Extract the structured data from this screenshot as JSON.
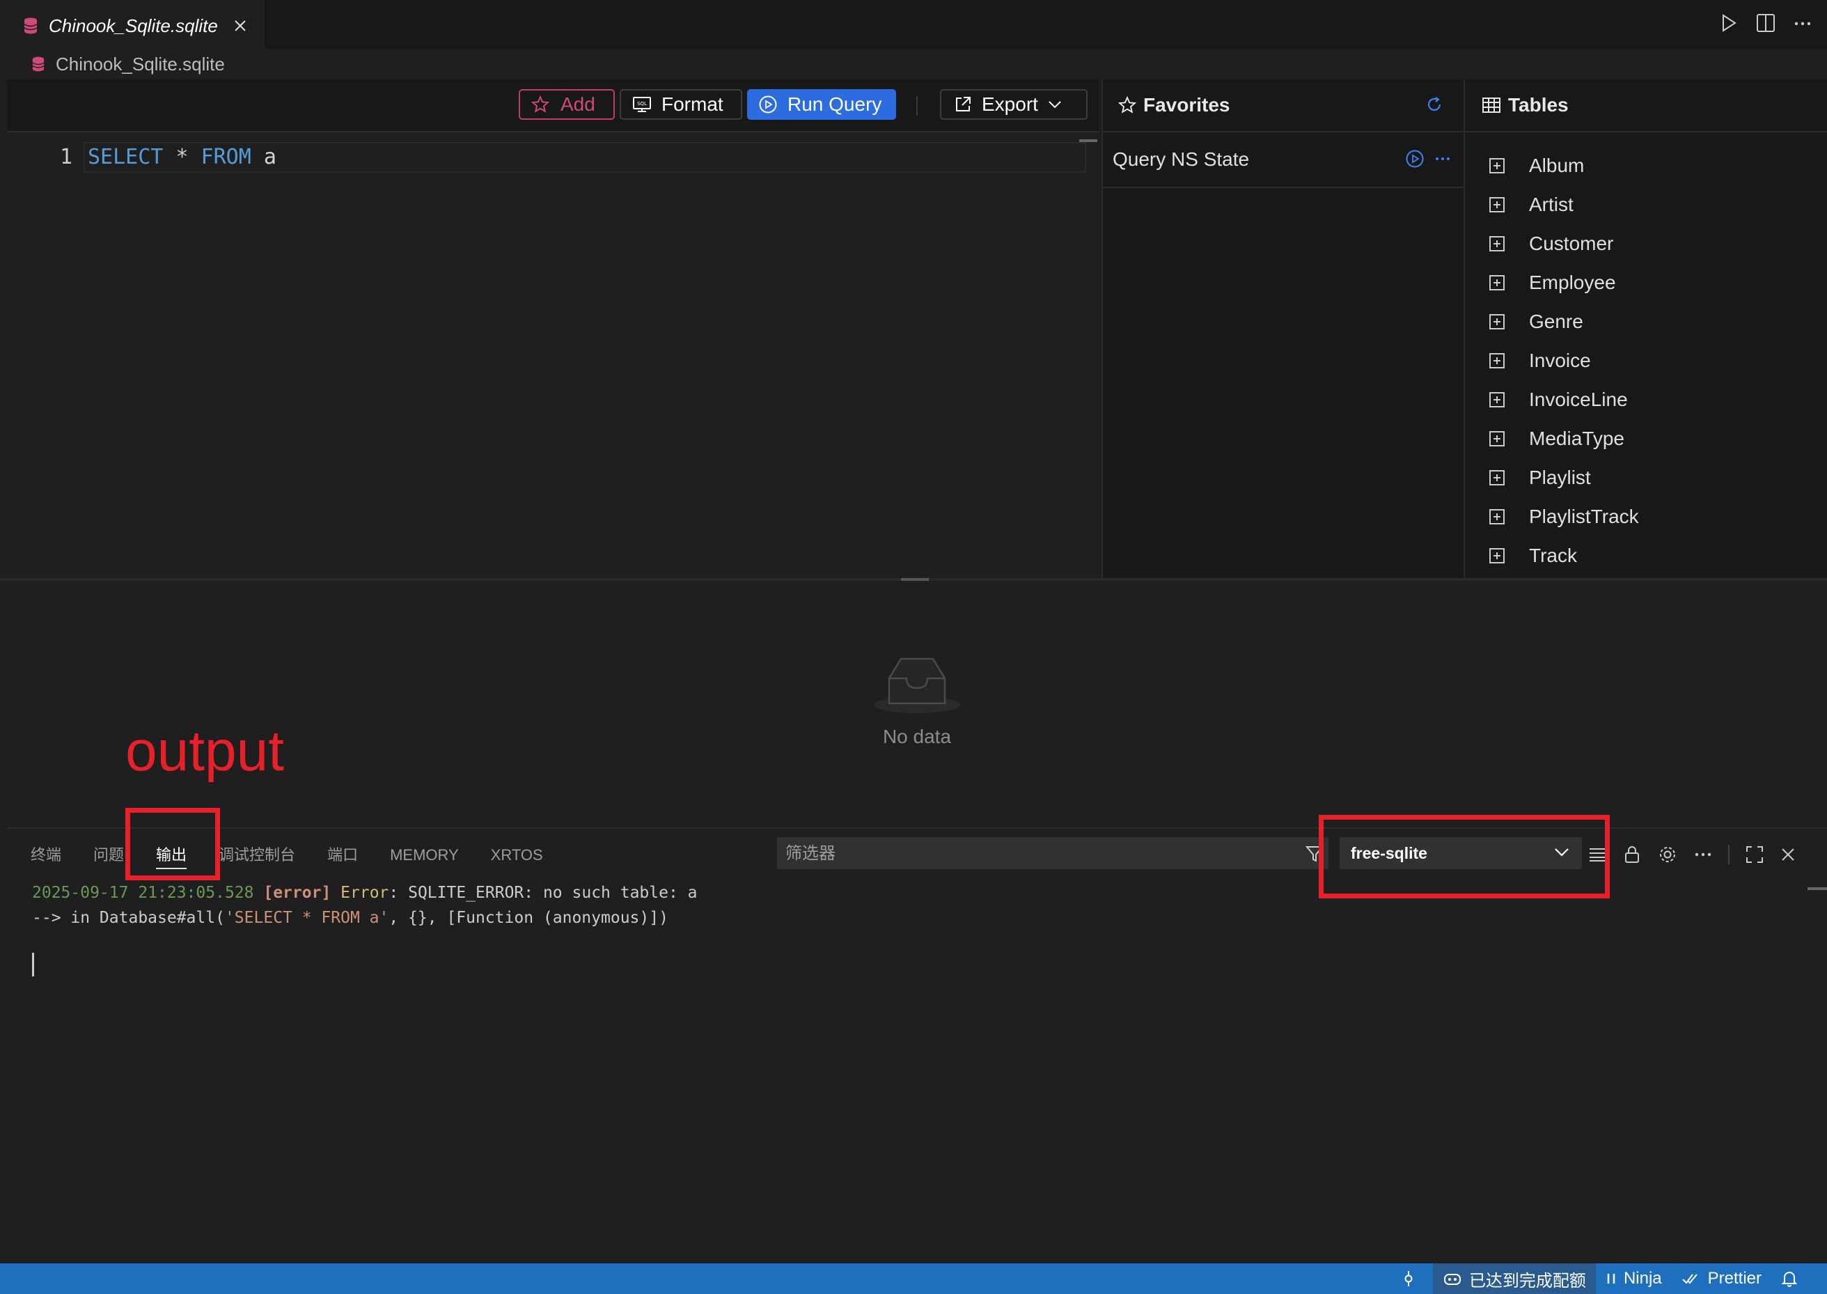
{
  "tab": {
    "title": "Chinook_Sqlite.sqlite"
  },
  "breadcrumb": {
    "label": "Chinook_Sqlite.sqlite"
  },
  "toolbar": {
    "add": "Add",
    "format": "Format",
    "run": "Run Query",
    "export": "Export"
  },
  "editor": {
    "line_number": "1",
    "code": {
      "kw1": "SELECT",
      "star": "*",
      "kw2": "FROM",
      "ident": "a"
    }
  },
  "favorites": {
    "title": "Favorites",
    "items": [
      {
        "label": "Query NS State"
      }
    ]
  },
  "tables": {
    "title": "Tables",
    "items": [
      "Album",
      "Artist",
      "Customer",
      "Employee",
      "Genre",
      "Invoice",
      "InvoiceLine",
      "MediaType",
      "Playlist",
      "PlaylistTrack",
      "Track"
    ]
  },
  "results": {
    "empty": "No data"
  },
  "annotation": {
    "label": "output"
  },
  "panel": {
    "tabs": [
      "终端",
      "问题",
      "输出",
      "调试控制台",
      "端口",
      "MEMORY",
      "XRTOS"
    ],
    "active_tab": "输出",
    "filter_placeholder": "筛选器",
    "channel": "free-sqlite",
    "log": {
      "timestamp": "2025-09-17 21:23:05.528",
      "level": "[error]",
      "error_word": "Error",
      "message": ": SQLITE_ERROR: no such table: a",
      "line2_prefix": "--> in Database#all(",
      "line2_sql": "'SELECT * FROM a'",
      "line2_suffix": ", {}, [Function (anonymous)])"
    }
  },
  "statusbar": {
    "quota": "已达到完成配额",
    "ninja": "Ninja",
    "prettier": "Prettier"
  },
  "colors": {
    "accent": "#2d6cdf",
    "statusbar": "#1f6fbf",
    "annotation": "#e8202a",
    "add": "#d1487c"
  }
}
